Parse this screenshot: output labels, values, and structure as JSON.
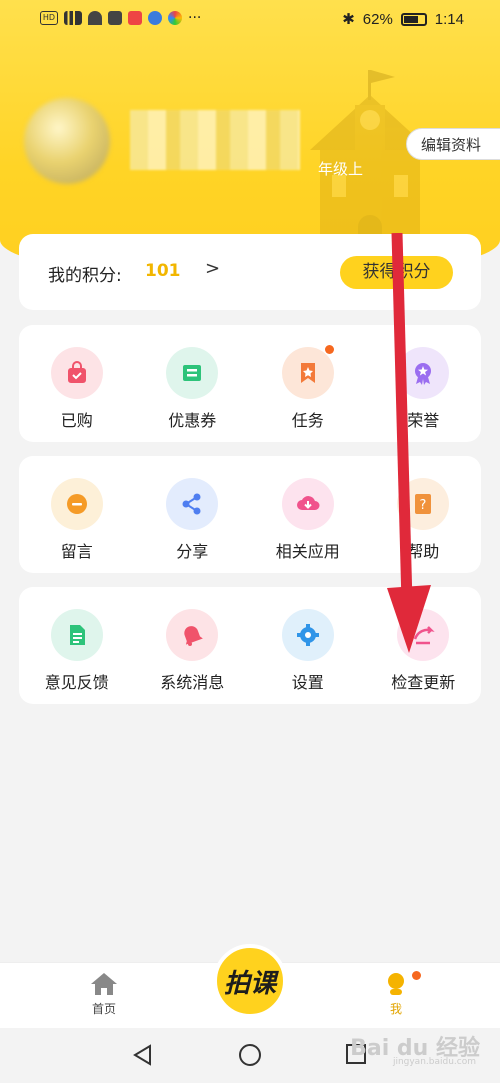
{
  "status": {
    "battery": "62%",
    "time": "1:14",
    "hd": "HD"
  },
  "profile": {
    "grade": "年级上",
    "edit_label": "编辑资料"
  },
  "points": {
    "label": "我的积分:",
    "value": "101",
    "arrow": ">",
    "earn_label": "获得积分"
  },
  "row1": [
    {
      "label": "已购",
      "icon": "shopping-bag-icon",
      "color": "#fde3e6",
      "fg": "#f0536b"
    },
    {
      "label": "优惠券",
      "icon": "coupon-icon",
      "color": "#dff5ec",
      "fg": "#2dc37a"
    },
    {
      "label": "任务",
      "icon": "task-bookmark-icon",
      "color": "#fde6d8",
      "fg": "#f37a3a"
    },
    {
      "label": "荣誉",
      "icon": "medal-icon",
      "color": "#efe5fb",
      "fg": "#9b6ef0"
    }
  ],
  "row2": [
    {
      "label": "留言",
      "icon": "message-icon",
      "color": "#fdf0d8",
      "fg": "#f59b27"
    },
    {
      "label": "分享",
      "icon": "share-icon",
      "color": "#e3ecfd",
      "fg": "#4f7ef0"
    },
    {
      "label": "相关应用",
      "icon": "cloud-download-icon",
      "color": "#fde3ee",
      "fg": "#f0538c"
    },
    {
      "label": "帮助",
      "icon": "help-icon",
      "color": "#fdeede",
      "fg": "#f0923c"
    }
  ],
  "row3": [
    {
      "label": "意见反馈",
      "icon": "feedback-doc-icon",
      "color": "#dff5ec",
      "fg": "#2dc37a"
    },
    {
      "label": "系统消息",
      "icon": "bell-icon",
      "color": "#fde3e6",
      "fg": "#f0536b"
    },
    {
      "label": "设置",
      "icon": "gear-icon",
      "color": "#e0f0fb",
      "fg": "#3095e8"
    },
    {
      "label": "检查更新",
      "icon": "update-icon",
      "color": "#fde3ee",
      "fg": "#f0538c"
    }
  ],
  "nav": {
    "home_label": "首页",
    "center_label": "拍课",
    "me_label": "我"
  },
  "watermark": {
    "text": "Bai du 经验",
    "sub": "jingyan.baidu.com"
  }
}
